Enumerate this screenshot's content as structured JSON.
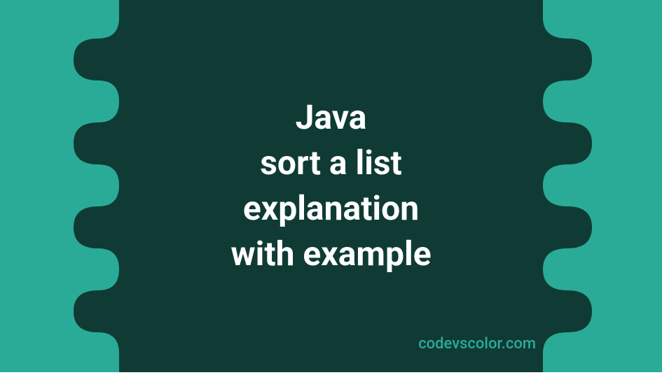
{
  "banner": {
    "title_line1": "Java",
    "title_line2": "sort a list",
    "title_line3": "explanation",
    "title_line4": "with example",
    "watermark": "codevscolor.com"
  },
  "colors": {
    "background_teal": "#2aab98",
    "dark_green": "#0f3b34",
    "text_white": "#ffffff"
  }
}
